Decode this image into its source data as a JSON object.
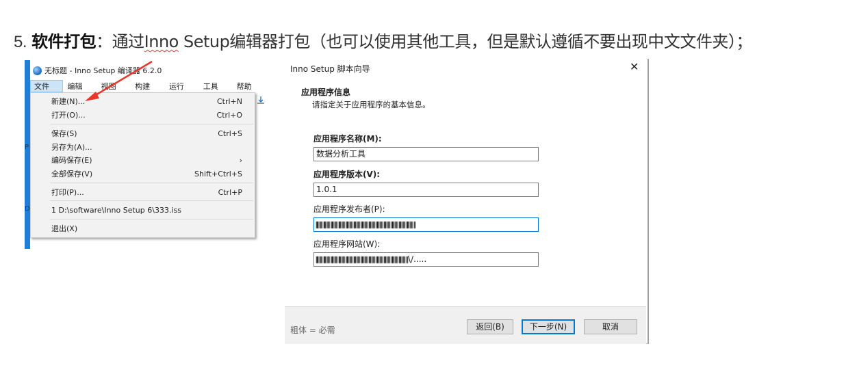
{
  "heading": {
    "number": "5.",
    "bold": "软件打包",
    "colon": "：",
    "pre": "通过",
    "squiggle": "Inno",
    "post": " Setup编辑器打包（也可以使用其他工具，但是默认遵循不要出现中文文件夹）；"
  },
  "editor": {
    "title": "无标题 - Inno Setup 编译器 6.2.0",
    "menus": [
      "文件(F)",
      "编辑(E)",
      "视图(V)",
      "构建(B)",
      "运行(R)",
      "工具(T)",
      "帮助(H)"
    ],
    "file_menu": [
      {
        "label": "新建(N)...",
        "shortcut": "Ctrl+N"
      },
      {
        "label": "打开(O)...",
        "shortcut": "Ctrl+O"
      },
      {
        "label": "保存(S)",
        "shortcut": "Ctrl+S"
      },
      {
        "label": "另存为(A)...",
        "shortcut": ""
      },
      {
        "label": "编码保存(E)",
        "shortcut": "›"
      },
      {
        "label": "全部保存(V)",
        "shortcut": "Shift+Ctrl+S"
      },
      {
        "label": "打印(P)...",
        "shortcut": "Ctrl+P"
      },
      {
        "label": "1 D:\\software\\Inno Setup 6\\333.iss",
        "shortcut": ""
      },
      {
        "label": "退出(X)",
        "shortcut": ""
      }
    ],
    "side_stubs": [
      "P",
      "D"
    ]
  },
  "wizard": {
    "title": "Inno Setup 脚本向导",
    "close": "✕",
    "section_title": "应用程序信息",
    "section_desc": "请指定关于应用程序的基本信息。",
    "fields": [
      {
        "label": "应用程序名称(M):",
        "value": "数据分析工具"
      },
      {
        "label": "应用程序版本(V):",
        "value": "1.0.1"
      },
      {
        "label": "应用程序发布者(P):",
        "value": ""
      },
      {
        "label": "应用程序网站(W):",
        "value": "\\/....."
      }
    ],
    "required_note": "粗体 = 必需",
    "buttons": {
      "back": "返回(B)",
      "next": "下一步(N)",
      "cancel": "取消"
    }
  },
  "colors": {
    "accent": "#0078d7",
    "arrow": "#e8372a",
    "editor_bar": "#1f7fd6"
  }
}
